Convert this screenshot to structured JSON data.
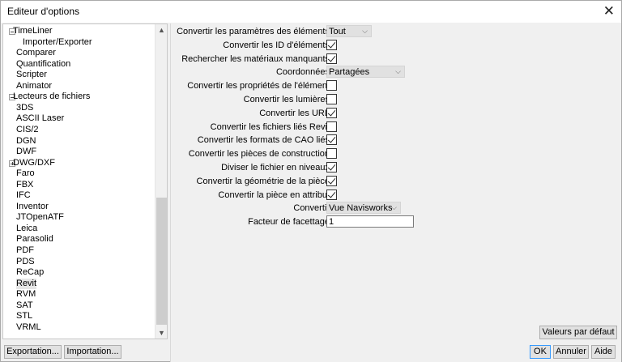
{
  "window": {
    "title": "Editeur d'options"
  },
  "tree": {
    "items": [
      {
        "label": "TimeLiner",
        "expander": "minus"
      },
      {
        "label": "Importer/Exporter"
      },
      {
        "label": "Comparer"
      },
      {
        "label": "Quantification"
      },
      {
        "label": "Scripter"
      },
      {
        "label": "Animator"
      },
      {
        "label": "Lecteurs de fichiers",
        "expander": "minus"
      },
      {
        "label": "3DS"
      },
      {
        "label": "ASCII Laser"
      },
      {
        "label": "CIS/2"
      },
      {
        "label": "DGN"
      },
      {
        "label": "DWF"
      },
      {
        "label": "DWG/DXF",
        "expander": "plus"
      },
      {
        "label": "Faro"
      },
      {
        "label": "FBX"
      },
      {
        "label": "IFC"
      },
      {
        "label": "Inventor"
      },
      {
        "label": "JTOpenATF"
      },
      {
        "label": "Leica"
      },
      {
        "label": "Parasolid"
      },
      {
        "label": "PDF"
      },
      {
        "label": "PDS"
      },
      {
        "label": "ReCap"
      },
      {
        "label": "Revit",
        "selected": true
      },
      {
        "label": "RVM"
      },
      {
        "label": "SAT"
      },
      {
        "label": "STL"
      },
      {
        "label": "VRML"
      }
    ]
  },
  "options": [
    {
      "label": "Convertir les paramètres des éléments",
      "type": "dropdown",
      "value": "Tout"
    },
    {
      "label": "Convertir les ID d'éléments",
      "type": "checkbox",
      "checked": true
    },
    {
      "label": "Rechercher les matériaux manquants",
      "type": "checkbox",
      "checked": true
    },
    {
      "label": "Coordonnées",
      "type": "dropdown",
      "value": "Partagées"
    },
    {
      "label": "Convertir les propriétés de l'élément",
      "type": "checkbox",
      "checked": false
    },
    {
      "label": "Convertir les lumières",
      "type": "checkbox",
      "checked": false
    },
    {
      "label": "Convertir les URL",
      "type": "checkbox",
      "checked": true
    },
    {
      "label": "Convertir les fichiers liés Revit",
      "type": "checkbox",
      "checked": false
    },
    {
      "label": "Convertir les formats de CAO liés",
      "type": "checkbox",
      "checked": true
    },
    {
      "label": "Convertir les pièces de construction",
      "type": "checkbox",
      "checked": false
    },
    {
      "label": "Diviser le fichier en niveaux",
      "type": "checkbox",
      "checked": true
    },
    {
      "label": "Convertir la géométrie de la pièce",
      "type": "checkbox",
      "checked": true
    },
    {
      "label": "Convertir la pièce en attribut",
      "type": "checkbox",
      "checked": true
    },
    {
      "label": "Convertir",
      "type": "dropdown",
      "value": "Vue Navisworks"
    },
    {
      "label": "Facteur de facettage",
      "type": "text",
      "value": "1"
    }
  ],
  "buttons": {
    "defaults": "Valeurs par défaut",
    "export": "Exportation...",
    "import": "Importation...",
    "ok": "OK",
    "cancel": "Annuler",
    "help": "Aide"
  }
}
